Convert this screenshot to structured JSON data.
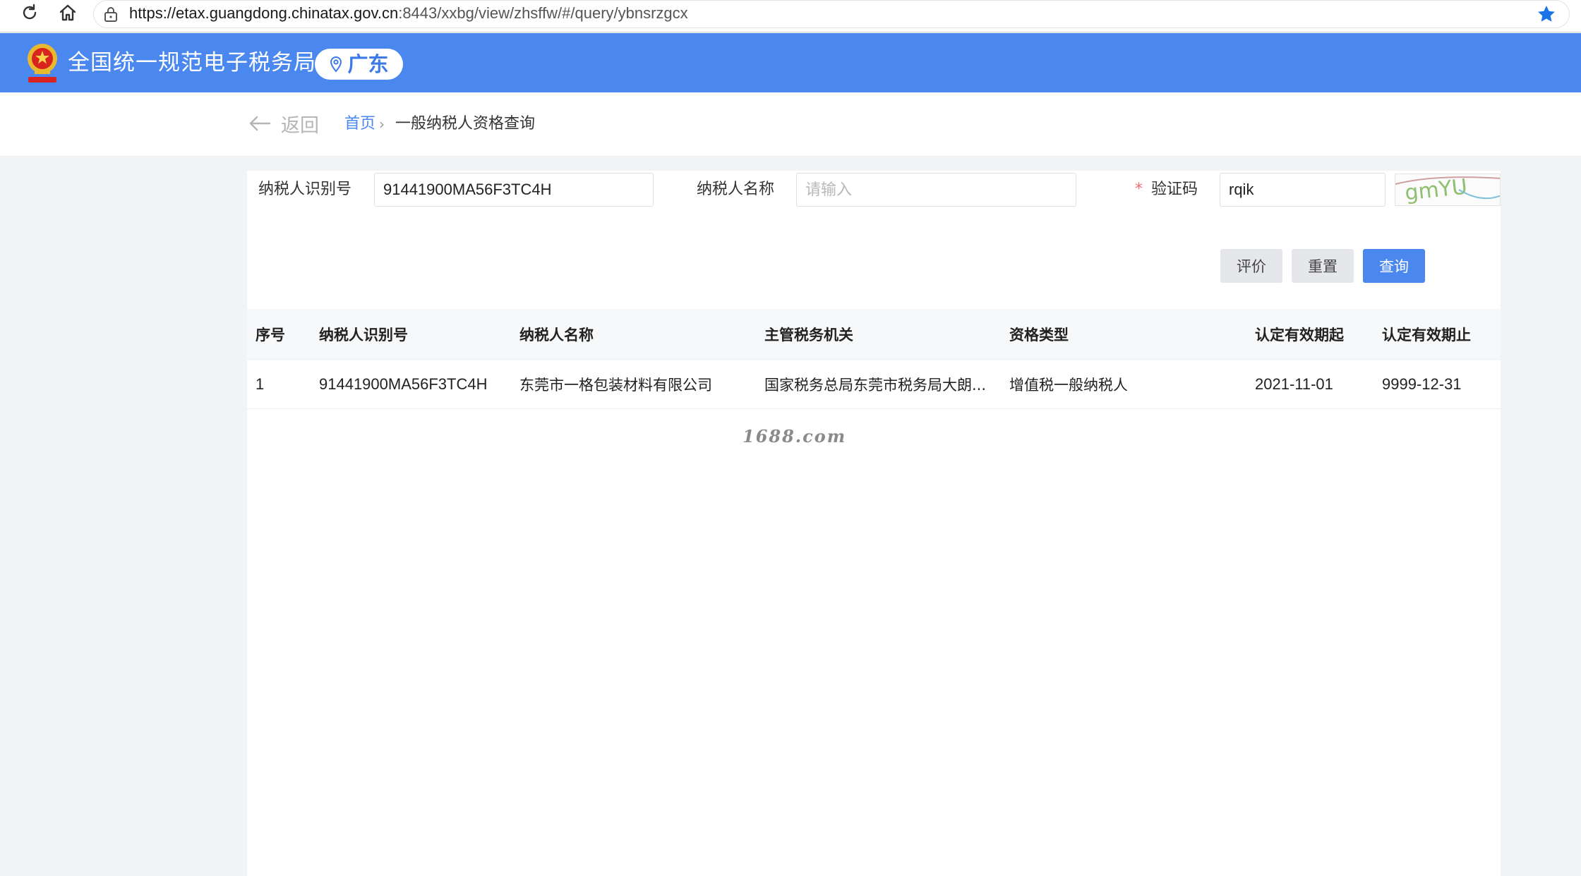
{
  "browser": {
    "url_host": "https://etax.guangdong.chinatax.gov.cn",
    "url_rest": ":8443/xxbg/view/zhsffw/#/query/ybnsrzgcx"
  },
  "header": {
    "title": "全国统一规范电子税务局",
    "region": "广东",
    "accent_color": "#4a88ef"
  },
  "breadcrumb": {
    "back": "返回",
    "home": "首页",
    "separator": "›",
    "current": "一般纳税人资格查询"
  },
  "form": {
    "taxpayer_id_label": "纳税人识别号",
    "taxpayer_id_value": "91441900MA56F3TC4H",
    "taxpayer_name_label": "纳税人名称",
    "taxpayer_name_placeholder": "请输入",
    "captcha_required_mark": "*",
    "captcha_label": "验证码",
    "captcha_value": "rqik",
    "captcha_image_text": "gmYU"
  },
  "buttons": {
    "evaluate": "评价",
    "reset": "重置",
    "query": "查询"
  },
  "table": {
    "columns": [
      "序号",
      "纳税人识别号",
      "纳税人名称",
      "主管税务机关",
      "资格类型",
      "认定有效期起",
      "认定有效期止"
    ],
    "rows": [
      {
        "index": "1",
        "taxpayer_id": "91441900MA56F3TC4H",
        "taxpayer_name": "东莞市一格包装材料有限公司",
        "tax_authority": "国家税务总局东莞市税务局大朗...",
        "qualification_type": "增值税一般纳税人",
        "valid_from": "2021-11-01",
        "valid_to": "9999-12-31"
      }
    ]
  },
  "watermark": "1688.com"
}
